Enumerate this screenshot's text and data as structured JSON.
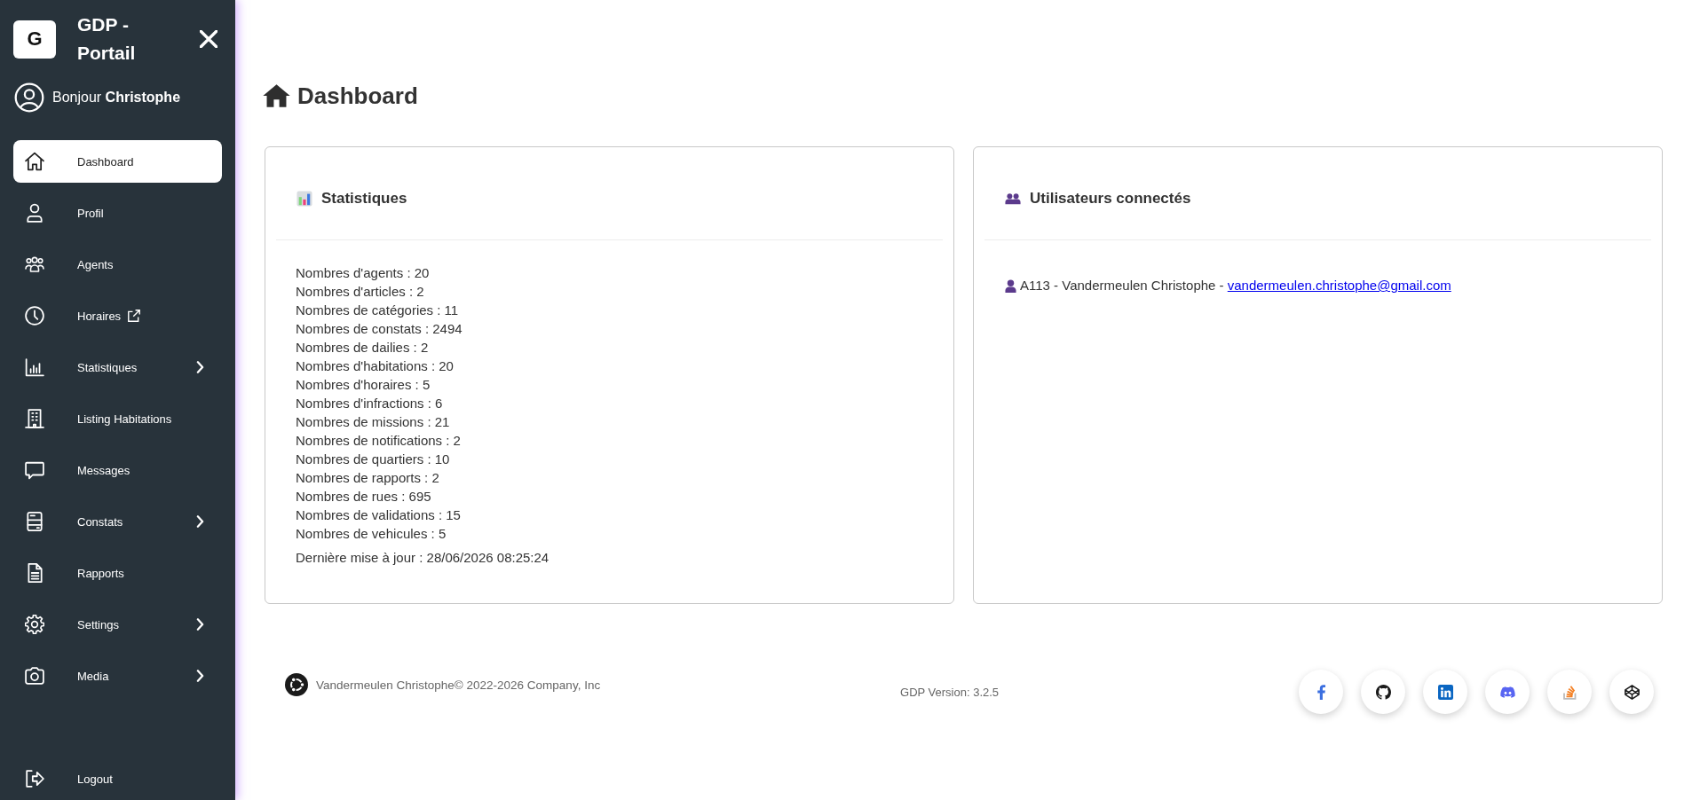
{
  "sidebar": {
    "logo_letter": "G",
    "app_name": "GDP - Portail",
    "greeting": "Bonjour **Christophe**",
    "items": [
      {
        "label": "Dashboard",
        "kind": "link",
        "selected": true
      },
      {
        "label": "Profil",
        "kind": "link",
        "selected": false
      },
      {
        "label": "Agents",
        "kind": "link",
        "selected": false
      },
      {
        "label": "Horaires",
        "kind": "external",
        "selected": false
      },
      {
        "label": "Statistiques",
        "kind": "group",
        "selected": false
      },
      {
        "label": "Listing Habitations",
        "kind": "link",
        "selected": false
      },
      {
        "label": "Messages",
        "kind": "link",
        "selected": false
      },
      {
        "label": "Constats",
        "kind": "group",
        "selected": false
      },
      {
        "label": "Rapports",
        "kind": "link",
        "selected": false
      },
      {
        "label": "Settings",
        "kind": "group",
        "selected": false
      },
      {
        "label": "Media",
        "kind": "group",
        "selected": false
      }
    ],
    "logout": "Logout"
  },
  "page_title": "Dashboard",
  "cards": [
    {
      "kind": "stats",
      "title": "Statistiques",
      "lines": [
        "Nombres d'agents : 20",
        "Nombres d'articles : 2",
        "Nombres de catégories : 11",
        "Nombres de constats : 2494",
        "Nombres de dailies : 2",
        "Nombres d'habitations : 20",
        "Nombres d'horaires : 5",
        "Nombres d'infractions : 6",
        "Nombres de missions : 21",
        "Nombres de notifications : 2",
        "Nombres de quartiers : 10",
        "Nombres de rapports : 2",
        "Nombres de rues : 695",
        "Nombres de validations : 15",
        "Nombres de vehicules : 5"
      ],
      "updated": "Dernière mise à jour : 28/06/2026 08:25:24"
    },
    {
      "kind": "users",
      "title": "Utilisateurs connectés",
      "users": [
        {
          "text": "A113 - Vandermeulen Christophe -",
          "email": "vandermeulen.christophe@gmail.com"
        }
      ]
    }
  ],
  "footer": {
    "copyright": "Vandermeulen Christophe© 2022-2026 Company, Inc",
    "version": "GDP Version: 3.2.5"
  }
}
